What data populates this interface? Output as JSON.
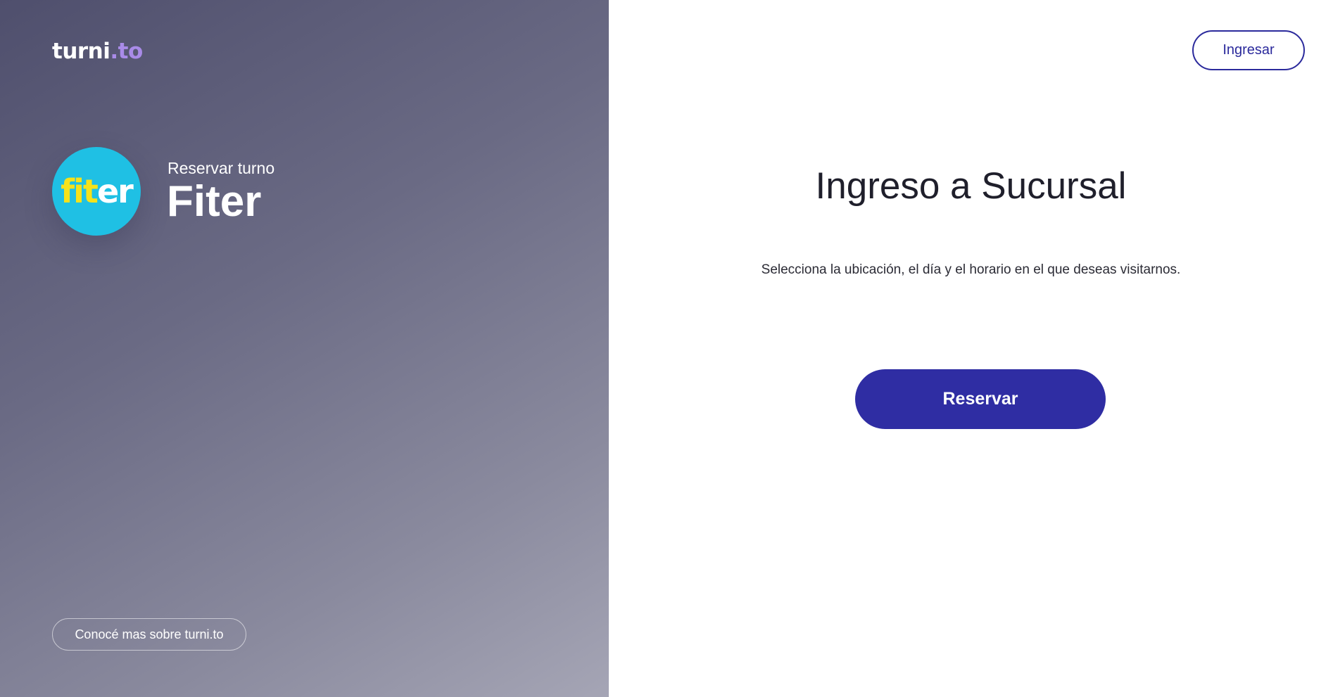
{
  "brand": {
    "name_main": "turni",
    "name_suffix": ".to"
  },
  "company": {
    "logo_part1": "fit",
    "logo_part2": "er",
    "booking_label": "Reservar turno",
    "name": "Fiter"
  },
  "footer": {
    "about_link": "Conocé mas sobre turni.to"
  },
  "header": {
    "login_label": "Ingresar"
  },
  "main": {
    "title": "Ingreso a Sucursal",
    "subtitle": "Selecciona la ubicación, el día y el horario en el que deseas visitarnos.",
    "reserve_label": "Reservar"
  },
  "colors": {
    "accent": "#2f2da3",
    "logo_bg": "#1fc0e4",
    "logo_yellow": "#f5e21a",
    "brand_suffix": "#a98be8"
  }
}
